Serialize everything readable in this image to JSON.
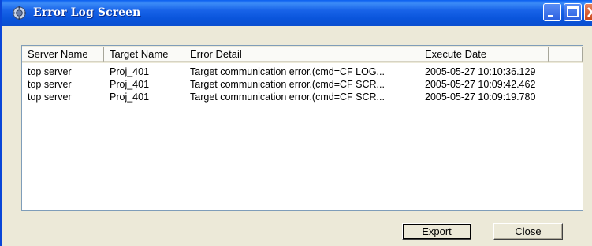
{
  "window": {
    "title": "Error Log Screen",
    "icon": "gear-icon"
  },
  "titlebar_buttons": {
    "minimize": "minimize-icon",
    "maximize": "maximize-icon",
    "close": "close-icon"
  },
  "table": {
    "columns": [
      "Server Name",
      "Target Name",
      "Error Detail",
      "Execute Date"
    ],
    "rows": [
      [
        "top server",
        "Proj_401",
        "Target communication error.(cmd=CF LOG...",
        "2005-05-27 10:10:36.129"
      ],
      [
        "top server",
        "Proj_401",
        "Target communication error.(cmd=CF SCR...",
        "2005-05-27 10:09:42.462"
      ],
      [
        "top server",
        "Proj_401",
        "Target communication error.(cmd=CF SCR...",
        "2005-05-27 10:09:19.780"
      ]
    ]
  },
  "buttons": {
    "export_label": "Export",
    "close_label": "Close"
  },
  "colors": {
    "titlebar": "#0a55dc",
    "window_bg": "#ece9d8"
  }
}
